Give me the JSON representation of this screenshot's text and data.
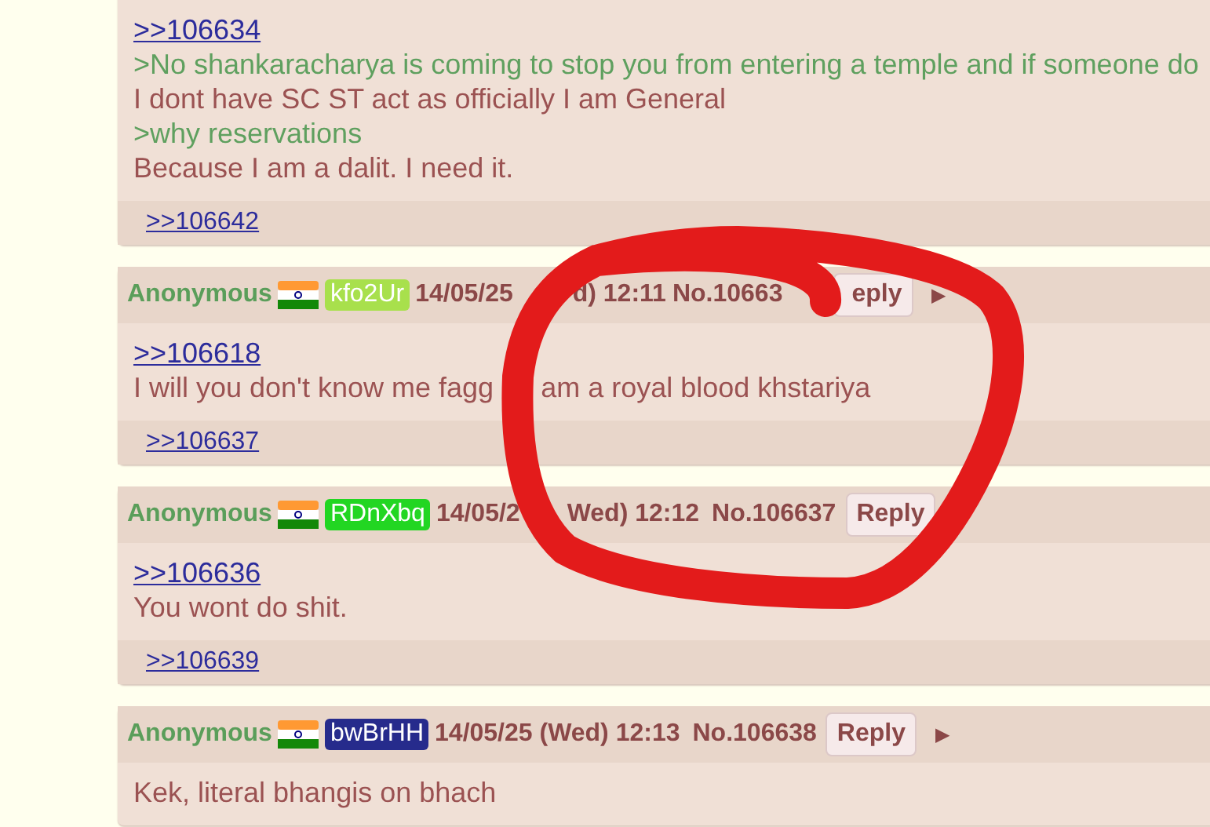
{
  "posts": [
    {
      "lines": [
        {
          "kind": "link",
          "parts": [
            ">>106634"
          ]
        },
        {
          "kind": "quote",
          "parts": [
            ">No shankaracharya is coming to stop you from entering a temple and if someone do"
          ]
        },
        {
          "kind": "text",
          "parts": [
            "I dont have SC ST act as officially I am General"
          ]
        },
        {
          "kind": "quote",
          "parts": [
            ">why reservations"
          ]
        },
        {
          "kind": "text",
          "parts": [
            "Because I am a dalit. I need it."
          ]
        }
      ],
      "backlinks": [
        ">>106642"
      ]
    },
    {
      "header": {
        "name": "Anonymous",
        "id": "kfo2Ur",
        "color": "#a8e04c",
        "date": [
          "14/05/25",
          "d) 12:11"
        ],
        "number": "No.10663",
        "reply": "eply",
        "menu": "▶"
      },
      "lines": [
        {
          "kind": "link",
          "parts": [
            ">>106618"
          ]
        },
        {
          "kind": "text",
          "parts": [
            "I will you don't know me fagg",
            "am a royal blood khstariya"
          ]
        }
      ],
      "backlinks": [
        ">>106637"
      ]
    },
    {
      "header": {
        "name": "Anonymous",
        "id": "RDnXbq",
        "color": "#22d622",
        "date": [
          "14/05/2",
          "Wed) 12:12"
        ],
        "number": "No.106637",
        "reply": "Reply"
      },
      "lines": [
        {
          "kind": "link",
          "parts": [
            ">>106636"
          ]
        },
        {
          "kind": "text",
          "parts": [
            "You wont do shit."
          ]
        }
      ],
      "backlinks": [
        ">>106639"
      ]
    },
    {
      "header": {
        "name": "Anonymous",
        "id": "bwBrHH",
        "color": "#262b8c",
        "date": [
          "14/05/25 (Wed) 12:13"
        ],
        "number": "No.106638",
        "reply": "Reply",
        "menu": "▶"
      },
      "lines": [
        {
          "kind": "text",
          "parts": [
            "Kek, literal bhangis on bhach"
          ]
        }
      ]
    }
  ]
}
